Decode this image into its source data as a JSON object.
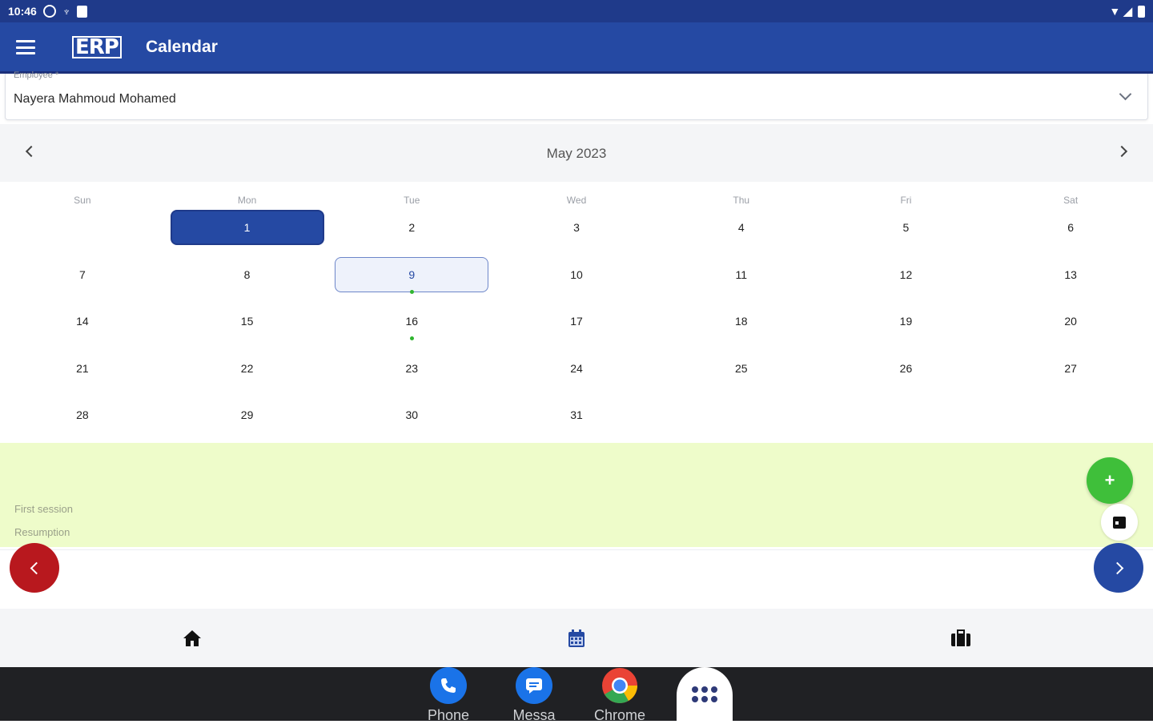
{
  "status_bar": {
    "time": "10:46",
    "icons": [
      "sim-icon",
      "usb-icon",
      "sd-card-icon"
    ],
    "right_icons": [
      "wifi-icon",
      "signal-icon",
      "battery-icon"
    ]
  },
  "app_bar": {
    "logo": "ERP",
    "title": "Calendar"
  },
  "employee": {
    "label": "Employee *",
    "value": "Nayera Mahmoud Mohamed"
  },
  "month": {
    "title": "May 2023"
  },
  "weekdays": [
    "Sun",
    "Mon",
    "Tue",
    "Wed",
    "Thu",
    "Fri",
    "Sat"
  ],
  "weeks": [
    [
      "",
      "1",
      "2",
      "3",
      "4",
      "5",
      "6"
    ],
    [
      "7",
      "8",
      "9",
      "10",
      "11",
      "12",
      "13"
    ],
    [
      "14",
      "15",
      "16",
      "17",
      "18",
      "19",
      "20"
    ],
    [
      "21",
      "22",
      "23",
      "24",
      "25",
      "26",
      "27"
    ],
    [
      "28",
      "29",
      "30",
      "31",
      "",
      "",
      ""
    ]
  ],
  "selected_day": "1",
  "today_day": "9",
  "event_days": [
    "9",
    "16"
  ],
  "events": [
    {
      "label": "First session"
    },
    {
      "label": "Resumption"
    }
  ],
  "fab": {
    "add_label": "+"
  },
  "bottom_nav": [
    "home-icon",
    "calendar-icon",
    "briefcase-icon"
  ],
  "dock": [
    {
      "label": "Phone",
      "icon": "phone-icon",
      "color": "#1a73e8"
    },
    {
      "label": "Messa",
      "icon": "messages-icon",
      "color": "#1a73e8"
    },
    {
      "label": "Chrome",
      "icon": "chrome-icon",
      "color": "#ea4335"
    }
  ],
  "colors": {
    "primary": "#2549a3",
    "accent_green": "#3fbf3a",
    "prev_red": "#b8181e",
    "events_bg": "#eefcca"
  }
}
